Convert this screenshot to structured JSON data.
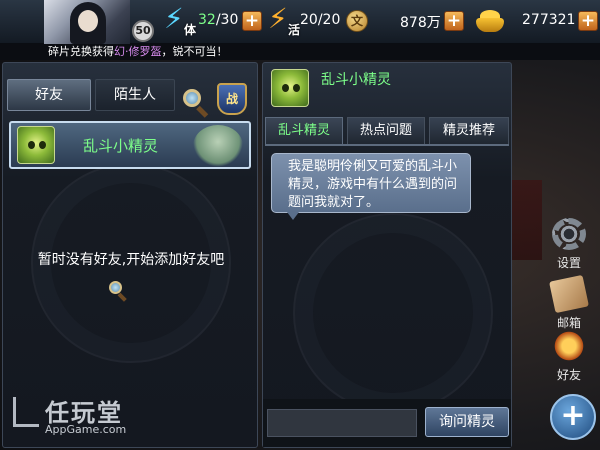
{
  "topbar": {
    "level": "50",
    "stamina": {
      "sub_label": "体",
      "current": "32",
      "max": "/30"
    },
    "activity": {
      "sub_label": "活",
      "value": "20/20"
    },
    "coins": {
      "icon": "coin-icon",
      "value": "878万"
    },
    "ingots": {
      "icon": "gold-ingot-icon",
      "value": "277321"
    },
    "plus_label": "+"
  },
  "ticker": {
    "before": "碎片兑换获得",
    "highlight": "幻·修罗盔",
    "after": "，锐不可当！"
  },
  "side_menu": [
    {
      "label": "设置",
      "icon": "gear-icon"
    },
    {
      "label": "邮箱",
      "icon": "mail-icon"
    },
    {
      "label": "好友",
      "icon": "friends-icon"
    }
  ],
  "fab_label": "+",
  "friends_panel": {
    "tabs": [
      "好友",
      "陌生人"
    ],
    "battle_label": "战",
    "sprite_entry": "乱斗小精灵",
    "empty_message": "暂时没有好友,开始添加好友吧"
  },
  "watermark": {
    "title": "任玩堂",
    "subtitle": "AppGame.com"
  },
  "sprite_panel": {
    "title": "乱斗小精灵",
    "tabs": [
      "乱斗精灵",
      "热点问题",
      "精灵推荐"
    ],
    "message": "我是聪明伶俐又可爱的乱斗小精灵，游戏中有什么遇到的问题问我就对了。",
    "input_value": "",
    "ask_button": "询问精灵"
  },
  "colors": {
    "accent_green": "#7dff8a",
    "highlight_purple": "#d98cf0",
    "plus_orange": "#e08a30"
  }
}
